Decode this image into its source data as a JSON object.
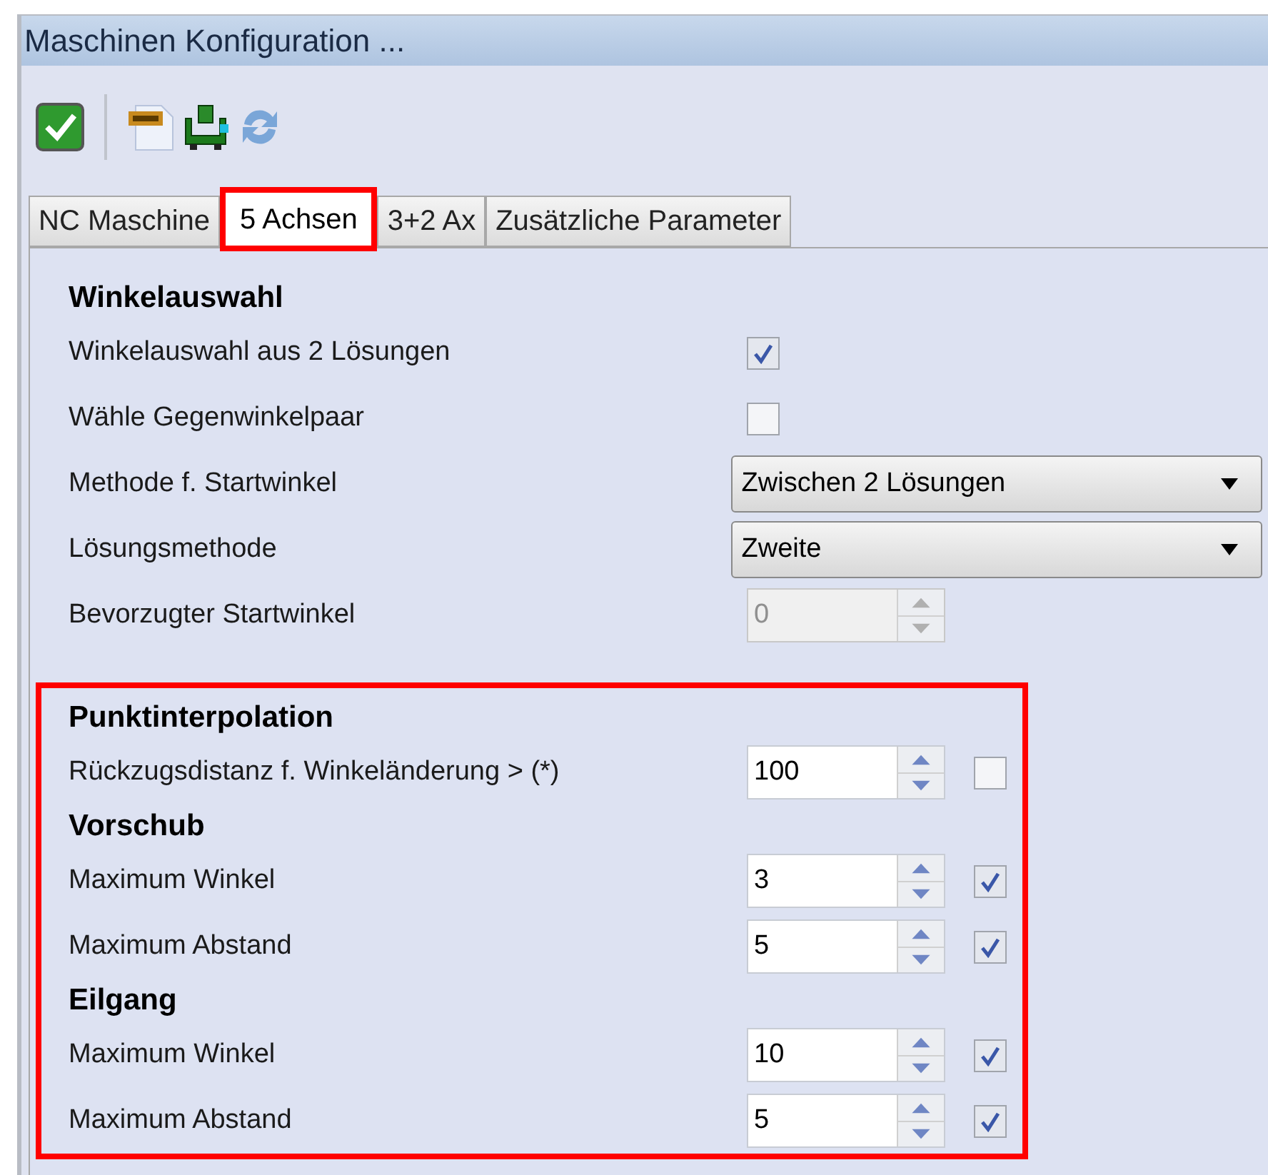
{
  "window": {
    "title": "Maschinen Konfiguration ..."
  },
  "toolbar": [
    {
      "kind": "apply"
    },
    {
      "kind": "separator"
    },
    {
      "kind": "xml"
    },
    {
      "kind": "machine"
    },
    {
      "kind": "refresh"
    }
  ],
  "tabs": [
    {
      "label": "NC Maschine",
      "selected": false
    },
    {
      "label": "5 Achsen",
      "selected": true
    },
    {
      "label": "3+2 Ax",
      "selected": false
    },
    {
      "label": "Zusätzliche Parameter",
      "selected": false
    }
  ],
  "sections": [
    {
      "highlighted": false,
      "groups": [
        {
          "heading": "Winkelauswahl",
          "rows": [
            {
              "kind": "checkbox",
              "label": "Winkelauswahl aus 2 Lösungen",
              "checked": true
            },
            {
              "kind": "checkbox",
              "label": "Wähle Gegenwinkelpaar",
              "checked": false
            },
            {
              "kind": "dropdown",
              "label": "Methode f. Startwinkel",
              "value": "Zwischen 2 Lösungen"
            },
            {
              "kind": "dropdown",
              "label": "Lösungsmethode",
              "value": "Zweite"
            },
            {
              "kind": "spinner",
              "label": "Bevorzugter Startwinkel",
              "value": "0",
              "disabled": true
            }
          ]
        }
      ]
    },
    {
      "highlighted": true,
      "groups": [
        {
          "heading": "Punktinterpolation",
          "rows": [
            {
              "kind": "spinner_check",
              "label": "Rückzugsdistanz f. Winkeländerung > (*)",
              "value": "100",
              "disabled": false,
              "checked": false
            }
          ]
        },
        {
          "heading": "Vorschub",
          "rows": [
            {
              "kind": "spinner_check",
              "label": "Maximum Winkel",
              "value": "3",
              "disabled": false,
              "checked": true
            },
            {
              "kind": "spinner_check",
              "label": "Maximum Abstand",
              "value": "5",
              "disabled": false,
              "checked": true
            }
          ]
        },
        {
          "heading": "Eilgang",
          "rows": [
            {
              "kind": "spinner_check",
              "label": "Maximum Winkel",
              "value": "10",
              "disabled": false,
              "checked": true
            },
            {
              "kind": "spinner_check",
              "label": "Maximum Abstand",
              "value": "5",
              "disabled": false,
              "checked": true
            }
          ]
        }
      ]
    }
  ]
}
